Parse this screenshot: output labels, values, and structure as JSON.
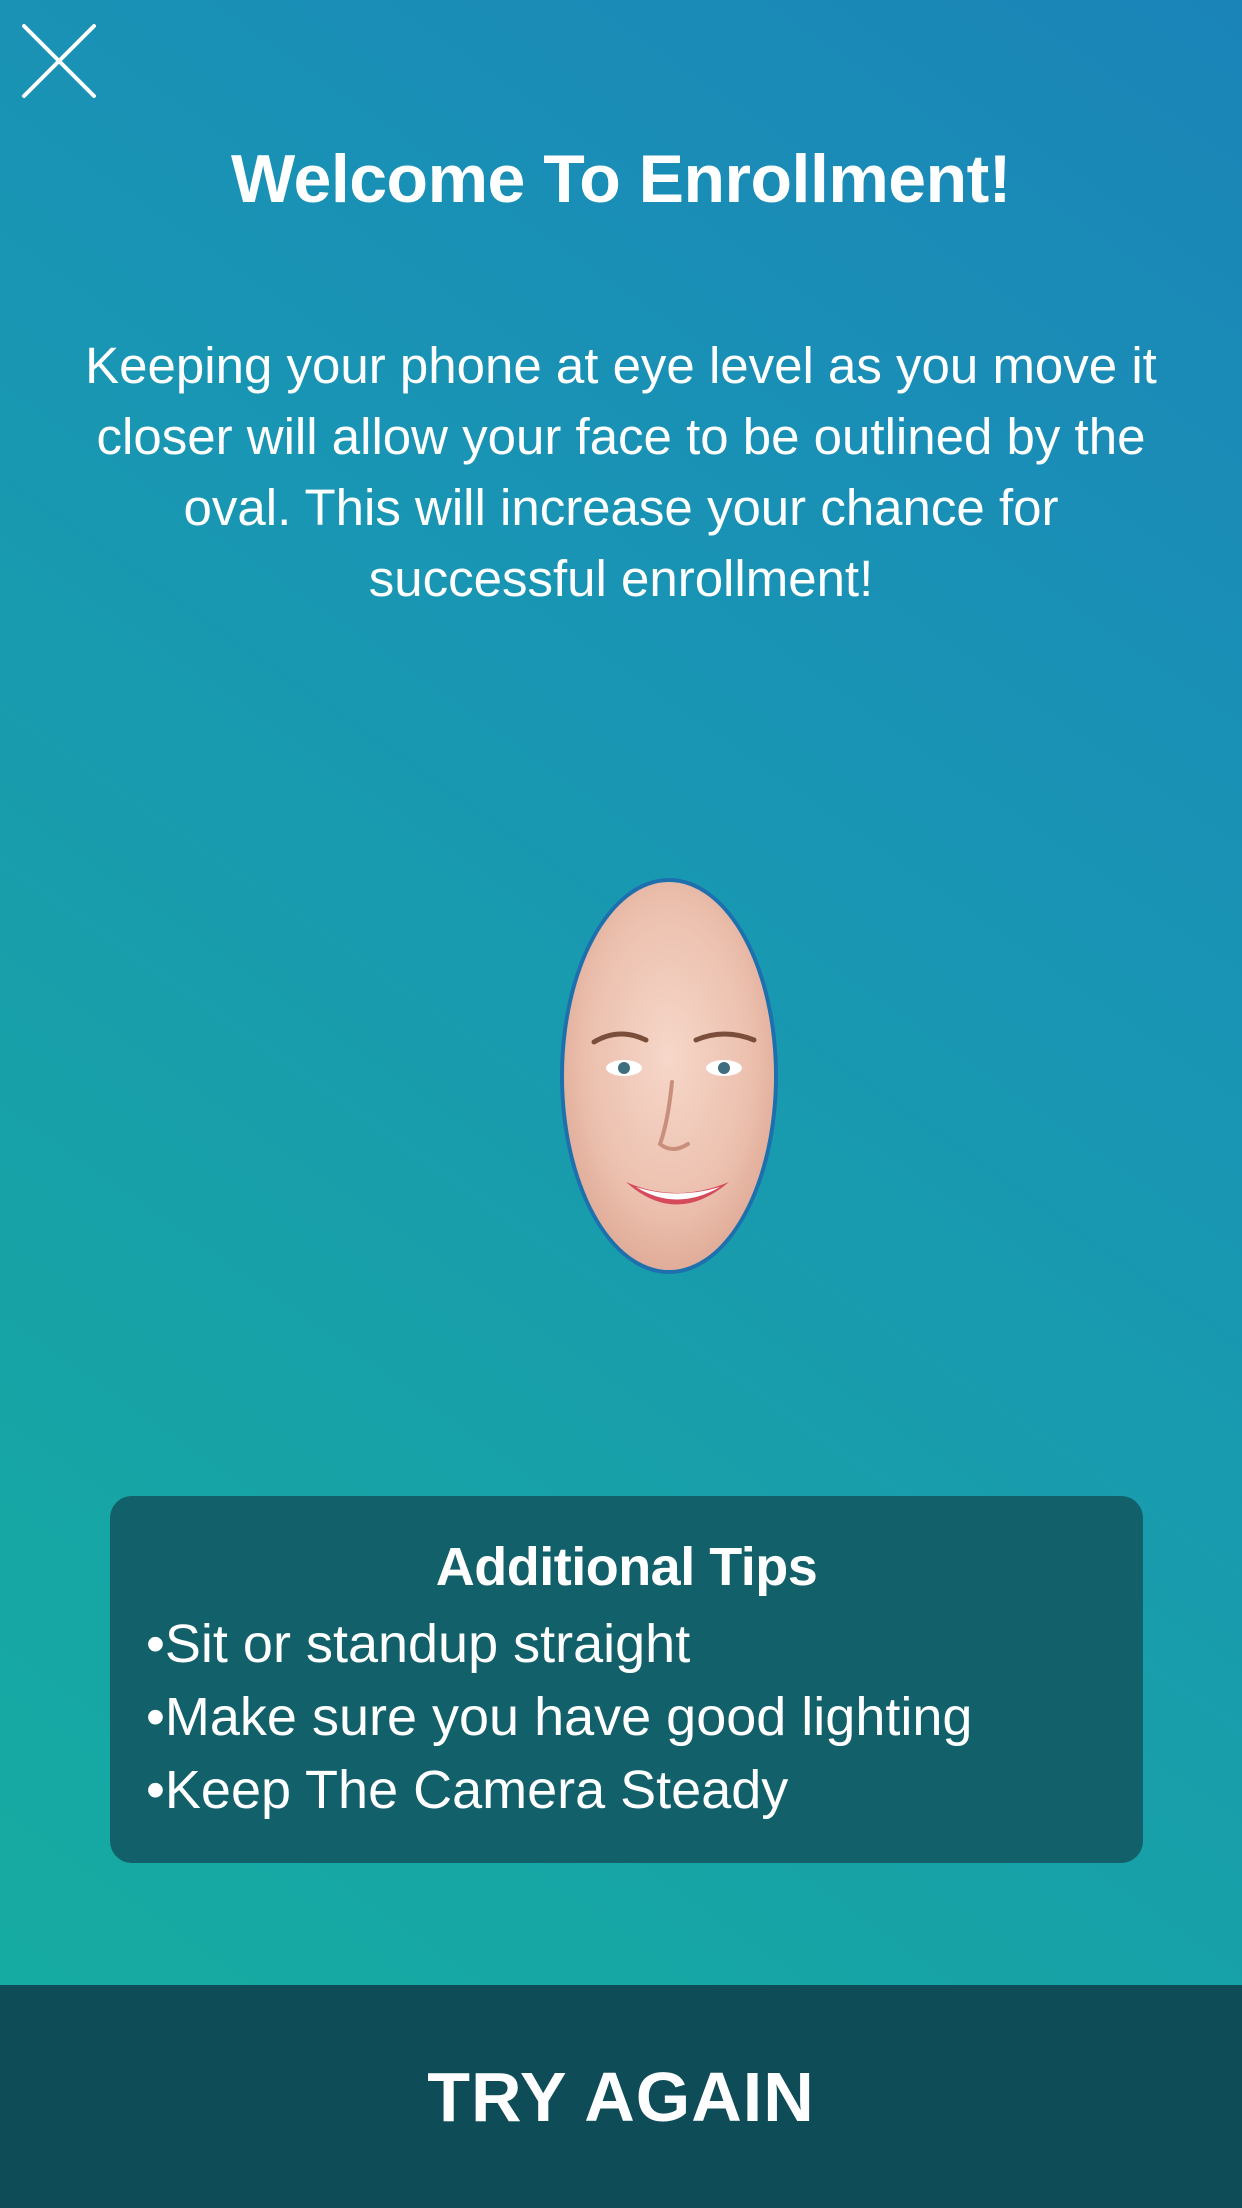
{
  "header": {
    "close_icon": "close-icon",
    "title": "Welcome To Enrollment!"
  },
  "instructions": {
    "text": "Keeping your phone at eye level as you move it closer will allow your face to be outlined by the oval. This will increase your chance for successful enrollment!"
  },
  "face_preview": {
    "icon": "face-oval-outline",
    "outline_color": "#1e6fae"
  },
  "tips": {
    "title": "Additional Tips",
    "items": [
      "Sit or standup straight",
      "Make sure you have good lighting",
      "Keep The Camera Steady"
    ]
  },
  "footer": {
    "button_label": "TRY AGAIN"
  },
  "colors": {
    "background_top": "#1a84b8",
    "background_bottom": "#15aea0",
    "tips_panel": "#12606a",
    "footer": "#0e4c58",
    "text": "#ffffff"
  }
}
